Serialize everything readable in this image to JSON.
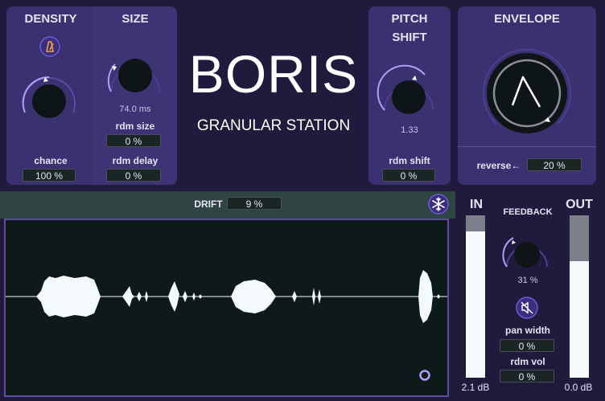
{
  "density": {
    "title": "DENSITY",
    "chance_label": "chance",
    "chance_value": "100 %"
  },
  "size": {
    "title": "SIZE",
    "value": "74.0 ms",
    "rdm_size_label": "rdm size",
    "rdm_size_value": "0 %",
    "rdm_delay_label": "rdm delay",
    "rdm_delay_value": "0 %"
  },
  "brand": {
    "name": "BORIS",
    "subtitle": "GRANULAR STATION"
  },
  "pitch": {
    "title_line1": "PITCH",
    "title_line2": "SHIFT",
    "value": "1.33",
    "rdm_shift_label": "rdm shift",
    "rdm_shift_value": "0 %"
  },
  "envelope": {
    "title": "ENVELOPE",
    "reverse_label": "reverse←",
    "reverse_value": "20 %"
  },
  "drift": {
    "label": "DRIFT",
    "value": "9 %"
  },
  "meters": {
    "in_label": "IN",
    "in_value": "2.1 dB",
    "in_level": 0.9,
    "out_label": "OUT",
    "out_value": "0.0 dB",
    "out_level": 0.72
  },
  "feedback": {
    "label": "FEEDBACK",
    "value": "31 %",
    "pan_width_label": "pan width",
    "pan_width_value": "0 %",
    "rdm_vol_label": "rdm vol",
    "rdm_vol_value": "0 %"
  },
  "colors": {
    "background": "#201b3d",
    "panel": "#3a3170",
    "knob": "#0e1517",
    "accent": "#9b7be8",
    "waveform": "#f4f9fb"
  },
  "icons": {
    "metronome": "metronome-icon",
    "freeze": "snowflake-icon",
    "mute": "speaker-mute-icon",
    "playhead": "ring-icon"
  }
}
